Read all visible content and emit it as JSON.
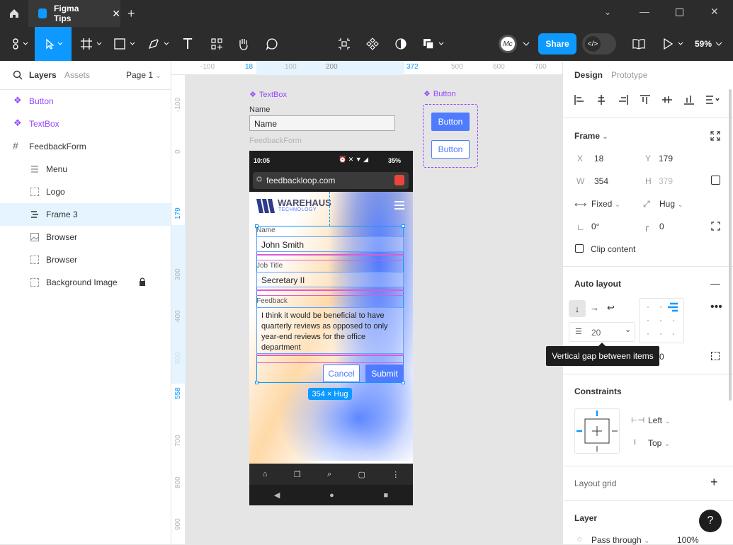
{
  "window": {
    "tab_title": "Figma Tips"
  },
  "toolbar": {
    "zoom": "59%",
    "share_label": "Share"
  },
  "left_panel": {
    "tabs": [
      "Layers",
      "Assets"
    ],
    "page": "Page 1",
    "layers": [
      {
        "name": "Button",
        "kind": "component"
      },
      {
        "name": "TextBox",
        "kind": "component"
      },
      {
        "name": "FeedbackForm",
        "kind": "frame"
      },
      {
        "name": "Menu",
        "kind": "child"
      },
      {
        "name": "Logo",
        "kind": "child"
      },
      {
        "name": "Frame 3",
        "kind": "child",
        "selected": true
      },
      {
        "name": "Browser",
        "kind": "child"
      },
      {
        "name": "Browser",
        "kind": "child"
      },
      {
        "name": "Background Image",
        "kind": "child",
        "locked": true
      }
    ]
  },
  "rulers": {
    "top": [
      "-100",
      "18",
      "100",
      "200",
      "372",
      "500",
      "600",
      "700"
    ],
    "left": [
      "-100",
      "0",
      "179",
      "300",
      "400",
      "500",
      "558",
      "700",
      "800",
      "900"
    ]
  },
  "canvas": {
    "textbox_component_label": "TextBox",
    "textbox_field_label": "Name",
    "textbox_field_value": "Name",
    "feedbackform_label": "FeedbackForm",
    "button_component_label": "Button",
    "button_primary": "Button",
    "button_secondary": "Button",
    "phone": {
      "time": "10:05",
      "battery": "35%",
      "url": "feedbackloop.com",
      "logo_main": "WAREHAUS",
      "logo_sub": "TECHNOLOGY",
      "name_label": "Name",
      "name_value": "John Smith",
      "job_label": "Job Title",
      "job_value": "Secretary II",
      "feedback_label": "Feedback",
      "feedback_value": "I think it would be beneficial to have quarterly reviews as opposed to only year-end reviews for the office department",
      "cancel": "Cancel",
      "submit": "Submit"
    },
    "size_badge": "354 × Hug"
  },
  "right_panel": {
    "tabs": [
      "Design",
      "Prototype"
    ],
    "frame_title": "Frame",
    "x_label": "X",
    "x": "18",
    "y_label": "Y",
    "y": "179",
    "w_label": "W",
    "w": "354",
    "h_label": "H",
    "h": "379",
    "width_mode": "Fixed",
    "height_mode": "Hug",
    "rotation": "0°",
    "radius": "0",
    "clip_content": "Clip content",
    "auto_layout_title": "Auto layout",
    "gap": "20",
    "padding_value": "0",
    "tooltip": "Vertical gap between items",
    "constraints_title": "Constraints",
    "constraint_h": "Left",
    "constraint_v": "Top",
    "layout_grid_title": "Layout grid",
    "layer_title": "Layer",
    "blend": "Pass through",
    "opacity": "100%",
    "help": "?"
  },
  "colors": {
    "accent": "#0d99ff",
    "component": "#9747ff",
    "primary_button": "#4f7cff",
    "dark": "#2c2c2c"
  }
}
